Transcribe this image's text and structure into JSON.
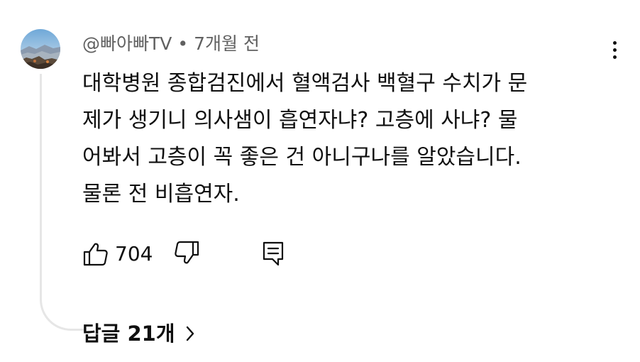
{
  "comment": {
    "author": "@빠아빠TV",
    "separator": "•",
    "time": "7개월 전",
    "avatar_icon": "mountain-landscape-avatar",
    "text_lines": [
      "대학병원 종합검진에서 혈액검사 백혈구 수치가 문",
      "제가 생기니 의사샘이 흡연자냐? 고층에 사냐? 물",
      "어봐서 고층이 꼭 좋은 건 아니구나를 알았습니다.",
      "물론 전 비흡연자."
    ],
    "likes": "704",
    "replies_label": "답글 21개"
  },
  "icons": {
    "more": "more-vert-icon",
    "like": "thumb-up-icon",
    "dislike": "thumb-down-icon",
    "reply": "reply-comment-icon",
    "chevron": "chevron-right-icon"
  },
  "colors": {
    "text": "#0f0f0f",
    "meta": "#606060",
    "thread_line": "#e6e6e6"
  }
}
